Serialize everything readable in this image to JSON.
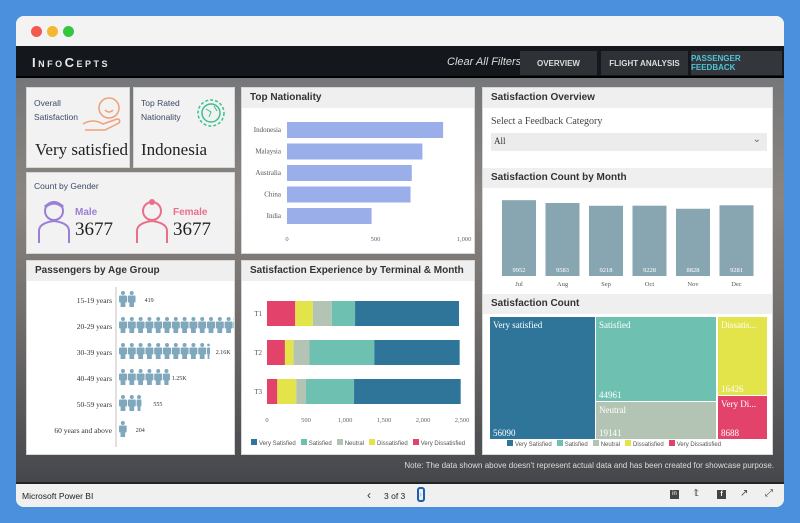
{
  "app": {
    "logo": "InfoCepts",
    "clear_filters": "Clear All Filters",
    "tabs": [
      "OVERVIEW",
      "FLIGHT ANALYSIS",
      "PASSENGER FEEDBACK"
    ],
    "active_tab": "PASSENGER FEEDBACK"
  },
  "kpi": {
    "overall_label": "Overall Satisfaction",
    "overall_value": "Very satisfied",
    "nationality_label": "Top Rated Nationality",
    "nationality_value": "Indonesia",
    "gender_label": "Count by Gender",
    "male_label": "Male",
    "male_value": "3677",
    "female_label": "Female",
    "female_value": "3677"
  },
  "right": {
    "overview_title": "Satisfaction Overview",
    "select_label": "Select a Feedback Category",
    "select_value": "All",
    "month_title": "Satisfaction Count by Month",
    "count_title": "Satisfaction Count"
  },
  "colors": {
    "very_satisfied": "#2e7599",
    "satisfied": "#6ec1b1",
    "neutral": "#b4c4b4",
    "dissatisfied": "#e3e34a",
    "very_dissatisfied": "#e3436b",
    "nationality_bar": "#9aaeea",
    "month_bar": "#88a6b2",
    "age_icon": "#7fa8bd"
  },
  "chart_data": [
    {
      "type": "bar",
      "title": "Top Nationality",
      "orientation": "horizontal",
      "categories": [
        "Indonesia",
        "Malaysia",
        "Australia",
        "China",
        "India"
      ],
      "values": [
        882,
        765,
        705,
        698,
        478
      ],
      "xlim": [
        0,
        1000
      ],
      "xticks": [
        "0",
        "500",
        "1,000"
      ]
    },
    {
      "type": "bar",
      "title": "Passengers by Age Group",
      "orientation": "horizontal",
      "categories": [
        "15-19 years",
        "20-29 years",
        "30-39 years",
        "40-49 years",
        "50-59 years",
        "60 years and above"
      ],
      "values": [
        419,
        2770,
        2160,
        1250,
        555,
        204
      ],
      "labels": [
        "419",
        "2.77K",
        "2.16K",
        "1.25K",
        "555",
        "204"
      ]
    },
    {
      "type": "bar",
      "stacked": true,
      "title": "Satisfaction Experience by Terminal & Month",
      "orientation": "horizontal",
      "categories": [
        "T1",
        "T2",
        "T3"
      ],
      "xlim": [
        0,
        2500
      ],
      "xticks": [
        "0",
        "500",
        "1,000",
        "1,500",
        "2,000",
        "2,500"
      ],
      "legend": "bottom",
      "series": [
        {
          "name": "Very Dissatisfied",
          "values": [
            362,
            230,
            132
          ]
        },
        {
          "name": "Dissatisfied",
          "values": [
            226,
            111,
            243
          ]
        },
        {
          "name": "Neutral",
          "values": [
            243,
            204,
            124
          ]
        },
        {
          "name": "Satisfied",
          "values": [
            298,
            830,
            617
          ]
        },
        {
          "name": "Very Satisfied",
          "values": [
            1333,
            1095,
            1367
          ]
        }
      ],
      "legend_order": [
        "Very Satisfied",
        "Satisfied",
        "Neutral",
        "Dissatisfied",
        "Very Dissatisfied"
      ]
    },
    {
      "type": "bar",
      "title": "Satisfaction Count by Month",
      "categories": [
        "Jul",
        "Aug",
        "Sep",
        "Oct",
        "Nov",
        "Dec"
      ],
      "values": [
        9952,
        9583,
        9218,
        9228,
        8828,
        9281
      ]
    },
    {
      "type": "treemap",
      "title": "Satisfaction Count",
      "items": [
        {
          "label": "Very satisfied",
          "value": 56090
        },
        {
          "label": "Satisfied",
          "value": 44961
        },
        {
          "label": "Neutral",
          "value": 19141
        },
        {
          "label": "Dissatis...",
          "value": 16426
        },
        {
          "label": "Very Di...",
          "value": 8688
        }
      ],
      "legend": [
        "Very Satisfied",
        "Satisfied",
        "Neutral",
        "Dissatisfied",
        "Very Dissatisfied"
      ]
    }
  ],
  "note": "Note: The data shown above doesn't represent actual data and has been created for showcase purpose.",
  "footer": {
    "brand": "Microsoft Power BI",
    "page": "3 of 3"
  }
}
